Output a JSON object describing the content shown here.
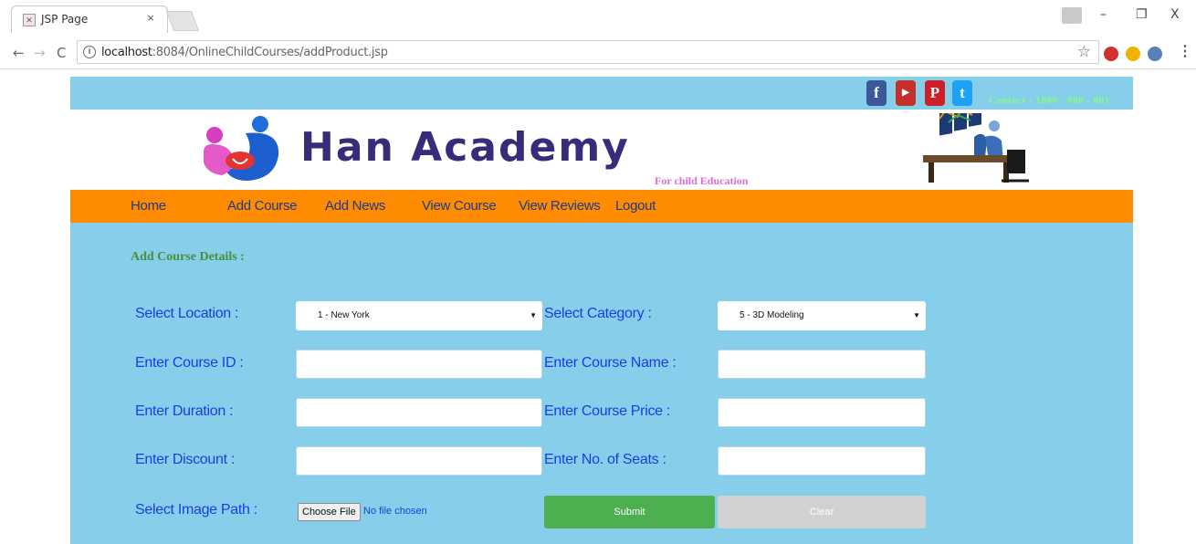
{
  "browser": {
    "tab_title": "JSP Page",
    "tab_close": "×",
    "window_minimize": "–",
    "window_restore": "❐",
    "window_close": "X",
    "url_host": "localhost",
    "url_path": ":8084/OnlineChildCourses/addProduct.jsp",
    "back_glyph": "←",
    "forward_glyph": "→",
    "reload_glyph": "C",
    "info_glyph": "i",
    "star_glyph": "☆",
    "menu_glyph": "⋮",
    "extensions": [
      {
        "name": "abp-icon",
        "color": "#d32f2f"
      },
      {
        "name": "norton-icon",
        "color": "#f0b400"
      },
      {
        "name": "shield-extension-icon",
        "color": "#5b7fb8"
      }
    ]
  },
  "header": {
    "social": [
      {
        "name": "facebook-icon",
        "glyph": "f",
        "color": "#3b5998"
      },
      {
        "name": "youtube-icon",
        "glyph": "▶",
        "color": "#c4302b"
      },
      {
        "name": "pinterest-icon",
        "glyph": "P",
        "color": "#cb2027"
      },
      {
        "name": "twitter-icon",
        "glyph": "t",
        "color": "#1da1f2"
      }
    ],
    "contact": "Contact : 1800 - 000 - 001",
    "brand": "Han Academy",
    "tagline": "For child Education"
  },
  "nav": {
    "items": [
      "Home",
      "Add Course",
      "Add News",
      "View Course",
      "View Reviews",
      "Logout"
    ]
  },
  "form": {
    "title": "Add Course Details :",
    "select_location_label": "Select Location :",
    "location_value": "1 - New York",
    "select_category_label": "Select Category :",
    "category_value": "5 - 3D Modeling",
    "course_id_label": "Enter Course ID :",
    "course_name_label": "Enter Course Name :",
    "duration_label": "Enter Duration :",
    "price_label": "Enter Course Price :",
    "discount_label": "Enter Discount :",
    "seats_label": "Enter No. of Seats :",
    "image_path_label": "Select Image Path :",
    "choose_file": "Choose File",
    "no_file": "No file chosen",
    "submit": "Submit",
    "clear": "Clear",
    "course_id_value": "",
    "course_name_value": "",
    "duration_value": "",
    "price_value": "",
    "discount_value": "",
    "seats_value": ""
  }
}
